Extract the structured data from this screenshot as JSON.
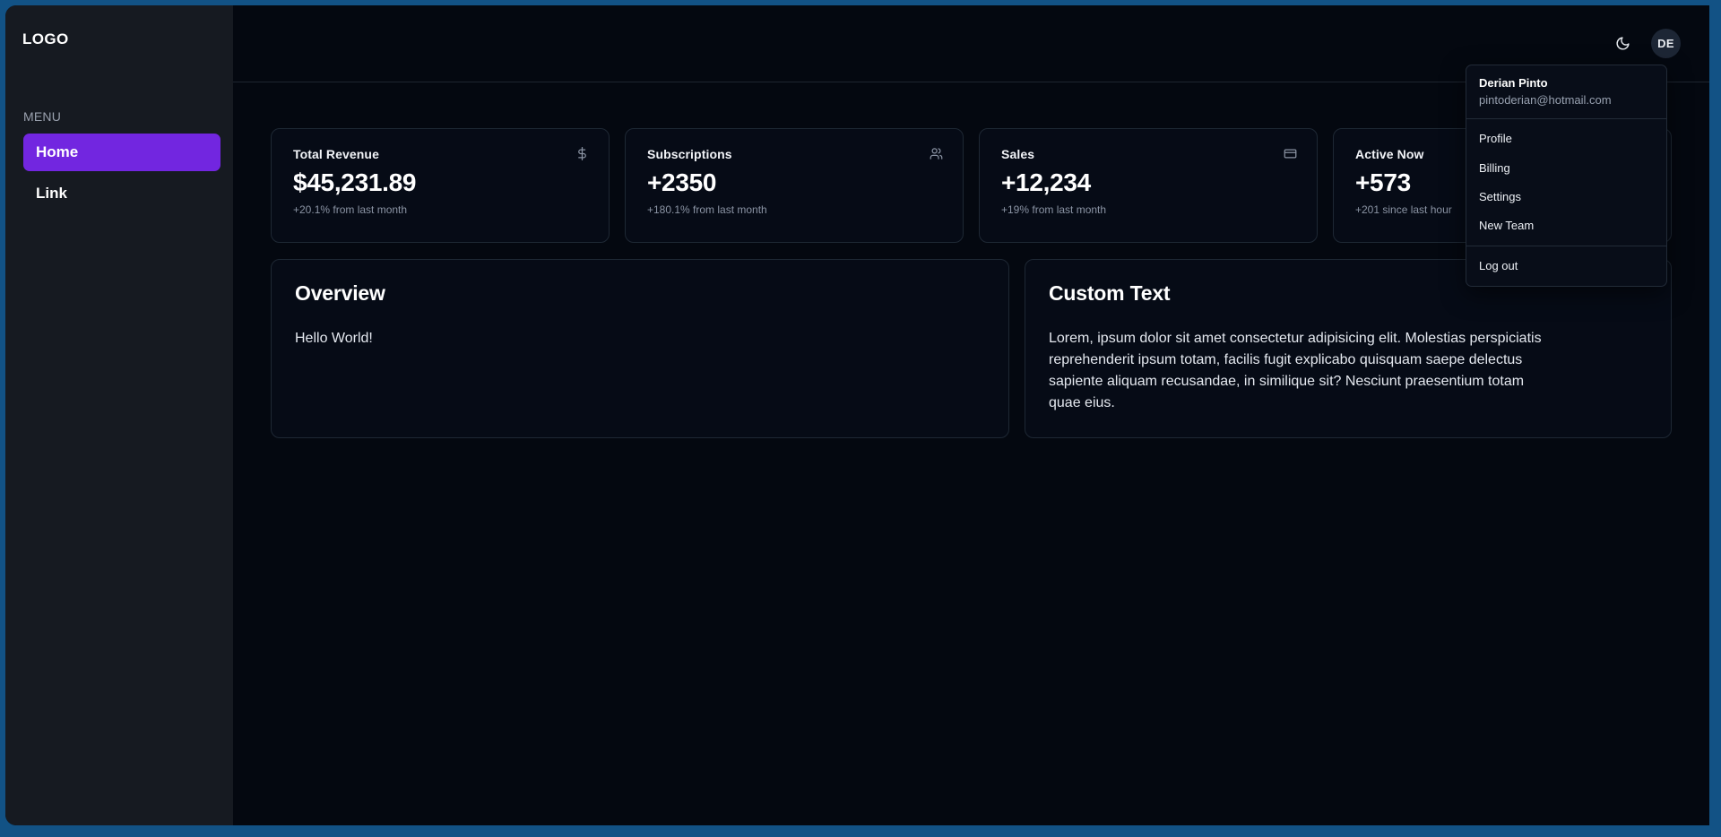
{
  "theme": {
    "accent": "#7226e0",
    "sidebar_bg": "#161a21",
    "main_bg": "#040810",
    "card_bg": "#060b16",
    "card_border": "#1e2834",
    "frame_blue": "#125285"
  },
  "sidebar": {
    "logo": "LOGO",
    "menu_label": "MENU",
    "items": [
      {
        "label": "Home",
        "active": true
      },
      {
        "label": "Link",
        "active": false
      }
    ]
  },
  "header": {
    "theme_toggle_icon": "moon-icon",
    "avatar_initials": "DE"
  },
  "user_menu": {
    "name": "Derian Pinto",
    "email": "pintoderian@hotmail.com",
    "items": [
      {
        "label": "Profile"
      },
      {
        "label": "Billing"
      },
      {
        "label": "Settings"
      },
      {
        "label": "New Team"
      }
    ],
    "logout_label": "Log out"
  },
  "stats": [
    {
      "title": "Total Revenue",
      "value": "$45,231.89",
      "sub": "+20.1% from last month",
      "icon": "dollar-icon"
    },
    {
      "title": "Subscriptions",
      "value": "+2350",
      "sub": "+180.1% from last month",
      "icon": "users-icon"
    },
    {
      "title": "Sales",
      "value": "+12,234",
      "sub": "+19% from last month",
      "icon": "credit-card-icon"
    },
    {
      "title": "Active Now",
      "value": "+573",
      "sub": "+201 since last hour",
      "icon": "activity-icon"
    }
  ],
  "panels": {
    "overview": {
      "title": "Overview",
      "body": "Hello World!"
    },
    "custom": {
      "title": "Custom Text",
      "body": "Lorem, ipsum dolor sit amet consectetur adipisicing elit. Molestias perspiciatis reprehenderit ipsum totam, facilis fugit explicabo quisquam saepe delectus sapiente aliquam recusandae, in similique sit? Nesciunt praesentium totam quae eius."
    }
  }
}
